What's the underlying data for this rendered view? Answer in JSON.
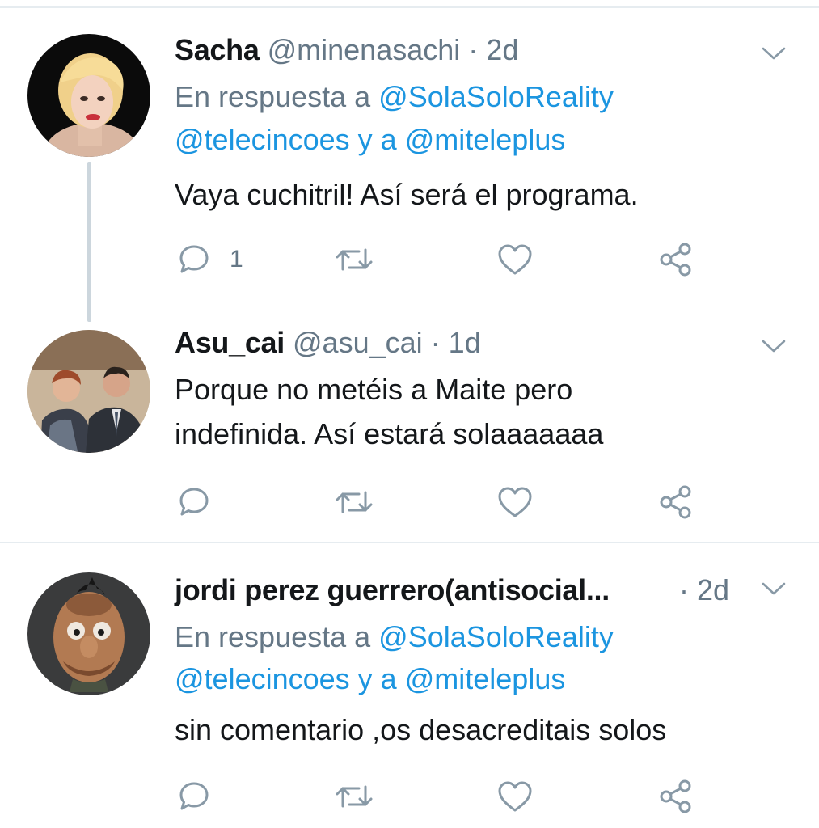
{
  "tweets": [
    {
      "name": "Sacha",
      "handle": "@minenasachi",
      "separator": "·",
      "time": "2d",
      "reply_prefix": "En respuesta a",
      "reply_to_1": "@SolaSoloReality",
      "reply_to_2": "@telecincoes",
      "reply_join": "y a",
      "reply_to_3": "@miteleplus",
      "text_lines": [
        "Vaya cuchitril! Así  será  el programa."
      ],
      "reply_count": "1",
      "avatar": "avatar-photo"
    },
    {
      "name": "Asu_cai",
      "handle": "@asu_cai",
      "separator": "·",
      "time": "1d",
      "text_lines": [
        "Porque no metéis a Maite pero",
        "indefinida. Así estará solaaaaaaa"
      ],
      "reply_count": "",
      "avatar": "avatar-photo"
    },
    {
      "name": "jordi perez guerrero(antisocial...",
      "handle": "",
      "separator": "·",
      "time": "2d",
      "reply_prefix": "En respuesta a",
      "reply_to_1": "@SolaSoloReality",
      "reply_to_2": "@telecincoes",
      "reply_join": "y a",
      "reply_to_3": "@miteleplus",
      "text_lines": [
        "sin comentario ,os desacreditais solos"
      ],
      "reply_count": "",
      "avatar": "avatar-photo"
    }
  ],
  "icons": [
    "reply-icon",
    "retweet-icon",
    "like-icon",
    "share-icon",
    "chevron-down-icon"
  ],
  "colors": {
    "link": "#1b95e0",
    "secondary_text": "#657786",
    "primary_text": "#14171a",
    "divider": "#e6ecf0",
    "thread_line": "#ccd6dd"
  }
}
